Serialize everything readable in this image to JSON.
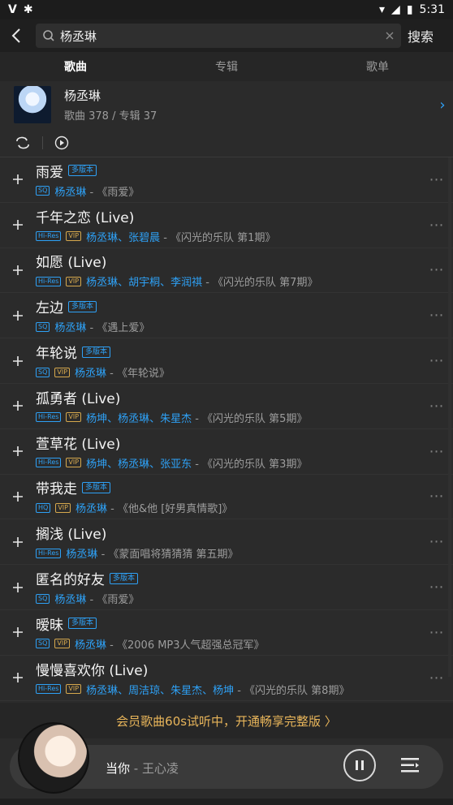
{
  "status": {
    "time": "5:31"
  },
  "search": {
    "query": "杨丞琳",
    "button_label": "搜索"
  },
  "tabs": [
    {
      "label": "歌曲",
      "active": true
    },
    {
      "label": "专辑",
      "active": false
    },
    {
      "label": "歌单",
      "active": false
    }
  ],
  "artist": {
    "name": "杨丞琳",
    "meta": "歌曲 378 / 专辑 37"
  },
  "songs": [
    {
      "title": "雨爱",
      "multi": "多版本",
      "quality": "SQ",
      "vip": false,
      "artists": "杨丞琳",
      "album": " - 《雨爱》"
    },
    {
      "title": "千年之恋 (Live)",
      "multi": "",
      "quality": "Hi-Res",
      "vip": true,
      "artists": "杨丞琳、张碧晨",
      "album": " - 《闪光的乐队 第1期》"
    },
    {
      "title": "如愿 (Live)",
      "multi": "",
      "quality": "Hi-Res",
      "vip": true,
      "artists": "杨丞琳、胡宇桐、李润祺",
      "album": " - 《闪光的乐队 第7期》"
    },
    {
      "title": "左边",
      "multi": "多版本",
      "quality": "SQ",
      "vip": false,
      "artists": "杨丞琳",
      "album": " - 《遇上爱》"
    },
    {
      "title": "年轮说",
      "multi": "多版本",
      "quality": "SQ",
      "vip": true,
      "artists": "杨丞琳",
      "album": " - 《年轮说》"
    },
    {
      "title": "孤勇者 (Live)",
      "multi": "",
      "quality": "Hi-Res",
      "vip": true,
      "artists": "杨坤、杨丞琳、朱星杰",
      "album": " - 《闪光的乐队 第5期》"
    },
    {
      "title": "萱草花 (Live)",
      "multi": "",
      "quality": "Hi-Res",
      "vip": true,
      "artists": "杨坤、杨丞琳、张亚东",
      "album": " - 《闪光的乐队 第3期》"
    },
    {
      "title": "带我走",
      "multi": "多版本",
      "quality": "HQ",
      "vip": true,
      "artists": "杨丞琳",
      "album": " - 《他&他 [好男真情歌]》"
    },
    {
      "title": "搁浅 (Live)",
      "multi": "",
      "quality": "Hi-Res",
      "vip": false,
      "artists": "杨丞琳",
      "album": " - 《蒙面唱将猜猜猜 第五期》"
    },
    {
      "title": "匿名的好友",
      "multi": "多版本",
      "quality": "SQ",
      "vip": false,
      "artists": "杨丞琳",
      "album": " - 《雨爱》"
    },
    {
      "title": "暧昧",
      "multi": "多版本",
      "quality": "SQ",
      "vip": true,
      "artists": "杨丞琳",
      "album": " - 《2006 MP3人气超强总冠军》"
    },
    {
      "title": "慢慢喜欢你 (Live)",
      "multi": "",
      "quality": "Hi-Res",
      "vip": true,
      "artists": "杨丞琳、周洁琼、朱星杰、杨坤",
      "album": " - 《闪光的乐队 第8期》"
    }
  ],
  "promo": {
    "text": "会员歌曲60s试听中，开通畅享完整版 〉"
  },
  "now_playing": {
    "title": "当你",
    "artist": "王心凌"
  },
  "colors": {
    "accent": "#2ea1f6",
    "vip": "#d6a84d",
    "promo": "#e8b55a"
  }
}
